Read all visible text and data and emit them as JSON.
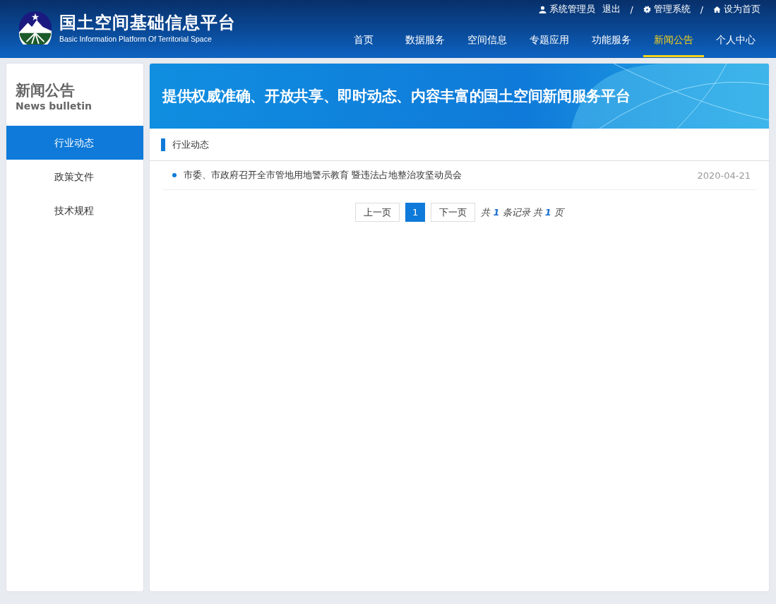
{
  "header": {
    "title": "国土空间基础信息平台",
    "subtitle": "Basic Information  Platform Of Territorial Space",
    "user_links": [
      {
        "kind": "user",
        "label": "系统管理员"
      },
      {
        "kind": "plain",
        "label": "退出"
      },
      {
        "kind": "sep",
        "label": "/"
      },
      {
        "kind": "gear",
        "label": "管理系统"
      },
      {
        "kind": "sep",
        "label": "/"
      },
      {
        "kind": "home",
        "label": "设为首页"
      }
    ],
    "nav": [
      {
        "label": "首页",
        "selected": false
      },
      {
        "label": "数据服务",
        "selected": false
      },
      {
        "label": "空间信息",
        "selected": false
      },
      {
        "label": "专题应用",
        "selected": false
      },
      {
        "label": "功能服务",
        "selected": false
      },
      {
        "label": "新闻公告",
        "selected": true
      },
      {
        "label": "个人中心",
        "selected": false
      }
    ]
  },
  "sidebar": {
    "title": "新闻公告",
    "subtitle": "News bulletin",
    "items": [
      {
        "label": "行业动态",
        "selected": true
      },
      {
        "label": "政策文件",
        "selected": false
      },
      {
        "label": "技术规程",
        "selected": false
      }
    ]
  },
  "banner": {
    "text": "提供权威准确、开放共享、即时动态、内容丰富的国土空间新闻服务平台"
  },
  "section": {
    "title": "行业动态"
  },
  "news": [
    {
      "title": "市委、市政府召开全市管地用地警示教育 暨违法占地整治攻坚动员会",
      "date": "2020-04-21"
    }
  ],
  "pagination": {
    "prev": "上一页",
    "pages": [
      {
        "label": "1",
        "selected": true
      }
    ],
    "next": "下一页",
    "summary": [
      {
        "kind": "text",
        "text": "共 "
      },
      {
        "kind": "number",
        "text": "1"
      },
      {
        "kind": "text",
        "text": " 条记录 共 "
      },
      {
        "kind": "number",
        "text": "1"
      },
      {
        "kind": "text",
        "text": " 页"
      }
    ]
  }
}
